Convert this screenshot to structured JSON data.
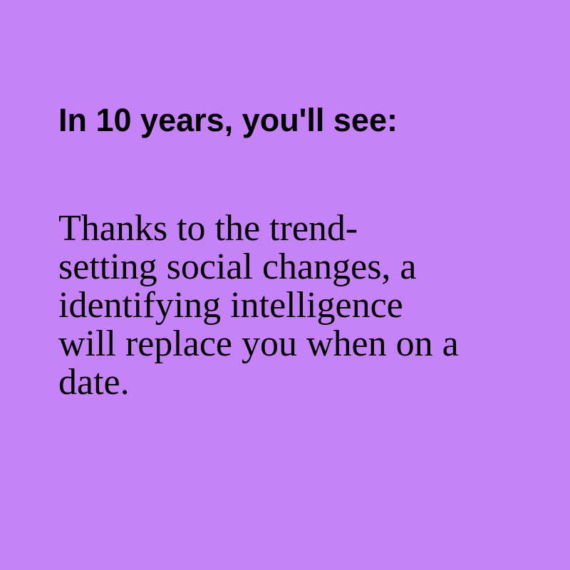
{
  "colors": {
    "background": "#c583f7",
    "text": "#000000"
  },
  "card": {
    "heading": "In 10 years, you'll see:",
    "body_lines": [
      "Thanks to the trend-",
      "setting social changes, a",
      "identifying intelligence",
      "will replace you when on a",
      "date."
    ]
  }
}
